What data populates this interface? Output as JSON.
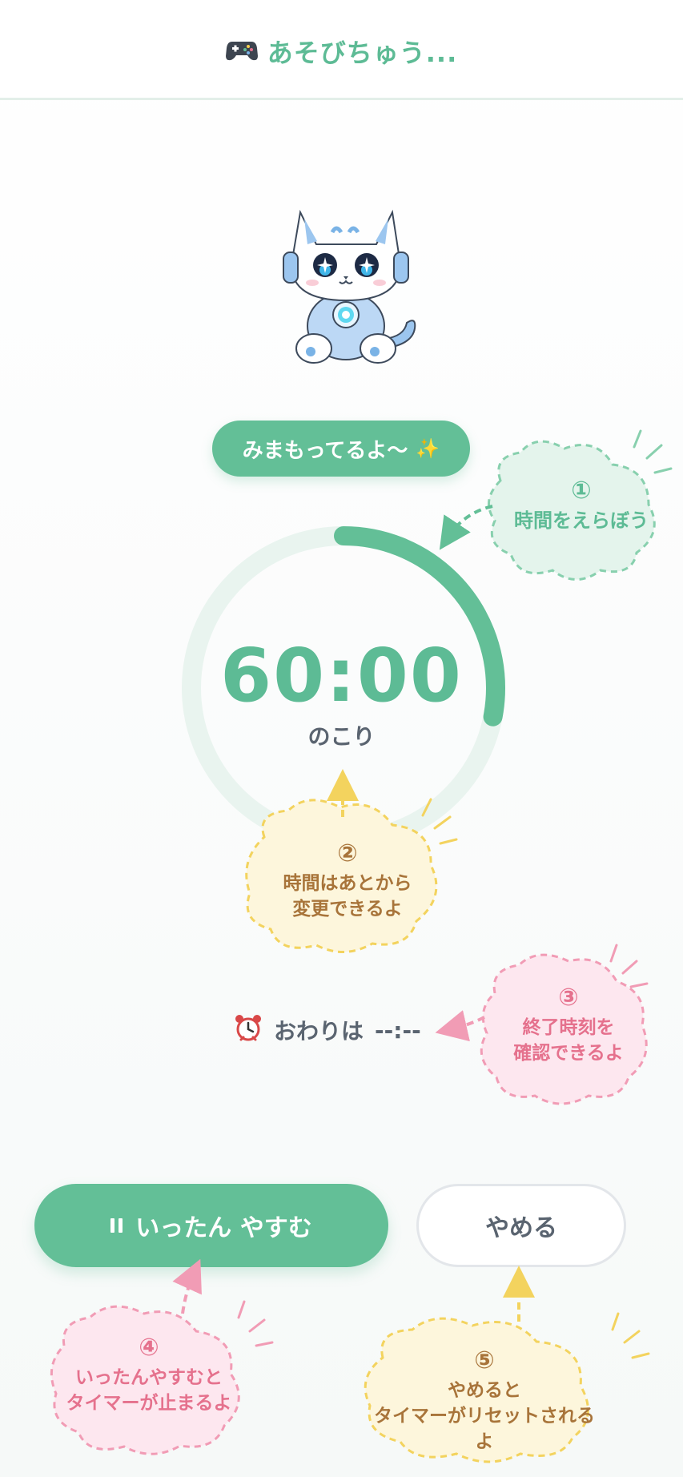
{
  "header": {
    "title": "あそびちゅう...",
    "icon": "game-controller-icon"
  },
  "status": {
    "label": "みまもってるよ〜",
    "icon": "sparkles-icon"
  },
  "timer": {
    "time": "60:00",
    "remaining_label": "のこり",
    "progress_fraction": 0.28
  },
  "end_time": {
    "icon": "alarm-clock-icon",
    "label": "おわりは",
    "value": "--:--"
  },
  "buttons": {
    "pause_label": "いったん やすむ",
    "pause_icon": "pause-icon",
    "stop_label": "やめる"
  },
  "tips": [
    {
      "number": "①",
      "lines": [
        "時間をえらぼう"
      ]
    },
    {
      "number": "②",
      "lines": [
        "時間はあとから",
        "変更できるよ"
      ]
    },
    {
      "number": "③",
      "lines": [
        "終了時刻を",
        "確認できるよ"
      ]
    },
    {
      "number": "④",
      "lines": [
        "いったんやすむと",
        "タイマーが止まるよ"
      ]
    },
    {
      "number": "⑤",
      "lines": [
        "やめると",
        "タイマーがリセットされるよ"
      ]
    }
  ],
  "colors": {
    "accent": "#63bf97",
    "accent_text": "#5dbb95",
    "tip_yellow": "#fdf6dc",
    "tip_pink": "#fde7ef",
    "tip_green": "#e4f4ec"
  }
}
